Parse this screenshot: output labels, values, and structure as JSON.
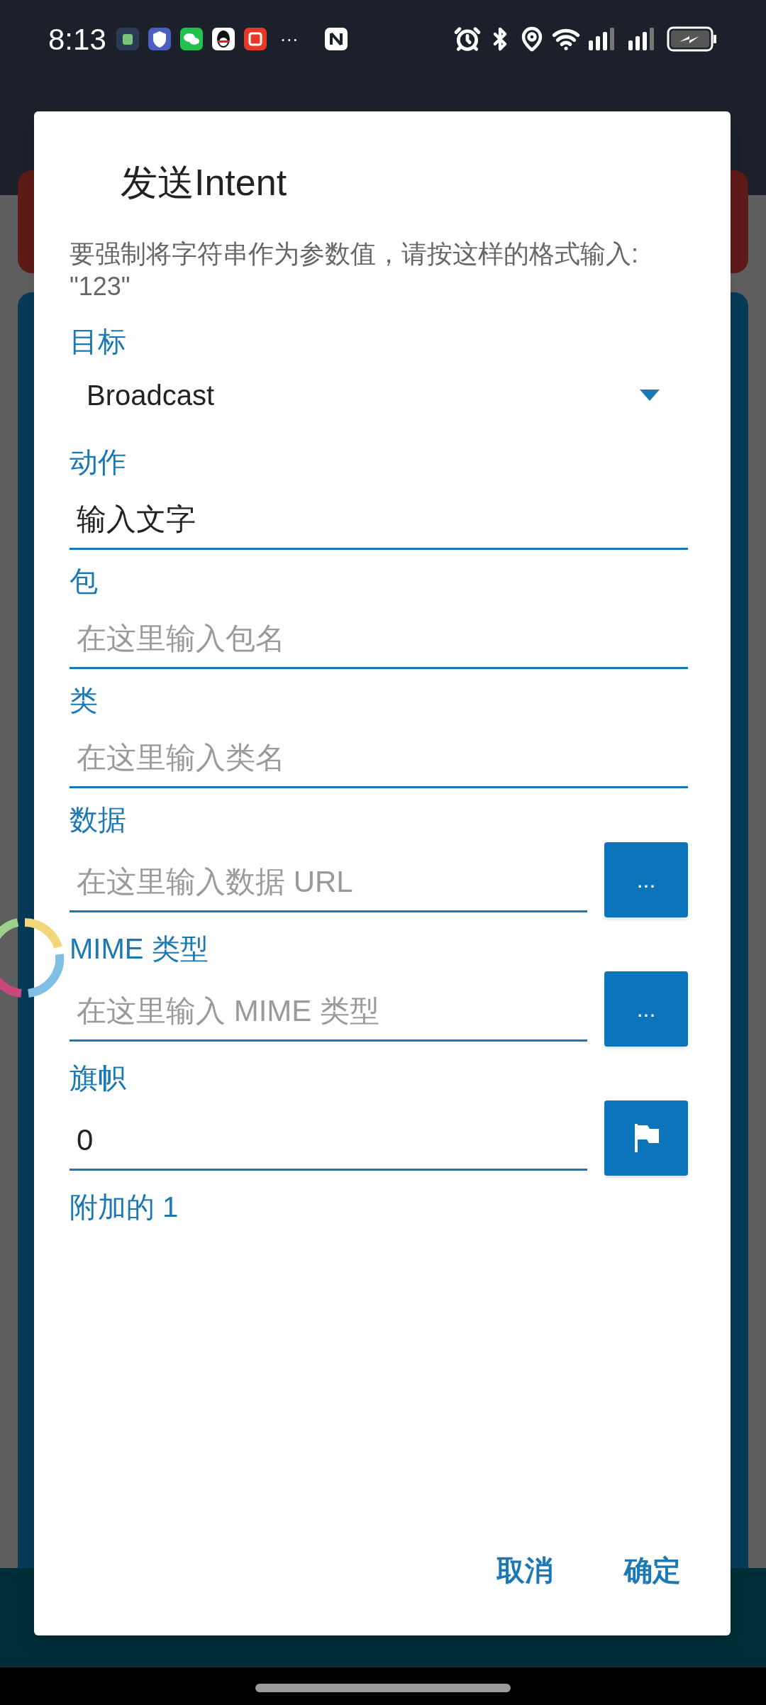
{
  "status_bar": {
    "time": "8:13",
    "more": "···"
  },
  "dialog": {
    "title": "发送Intent",
    "hint": "要强制将字符串作为参数值，请按这样的格式输入: \"123\"",
    "fields": [
      {
        "kind": "dropdown",
        "label": "目标",
        "value": "Broadcast"
      },
      {
        "kind": "text",
        "label": "动作",
        "value": "输入文字"
      },
      {
        "kind": "text",
        "label": "包",
        "placeholder": "在这里输入包名"
      },
      {
        "kind": "text",
        "label": "类",
        "placeholder": "在这里输入类名"
      },
      {
        "kind": "text_button",
        "label": "数据",
        "placeholder": "在这里输入数据 URL",
        "button": "..."
      },
      {
        "kind": "text_button",
        "label": "MIME 类型",
        "placeholder": "在这里输入 MIME 类型",
        "button": "..."
      },
      {
        "kind": "text_flag",
        "label": "旗帜",
        "value": "0"
      },
      {
        "kind": "section",
        "label": "附加的 1"
      }
    ],
    "buttons": [
      "取消",
      "确定"
    ]
  }
}
